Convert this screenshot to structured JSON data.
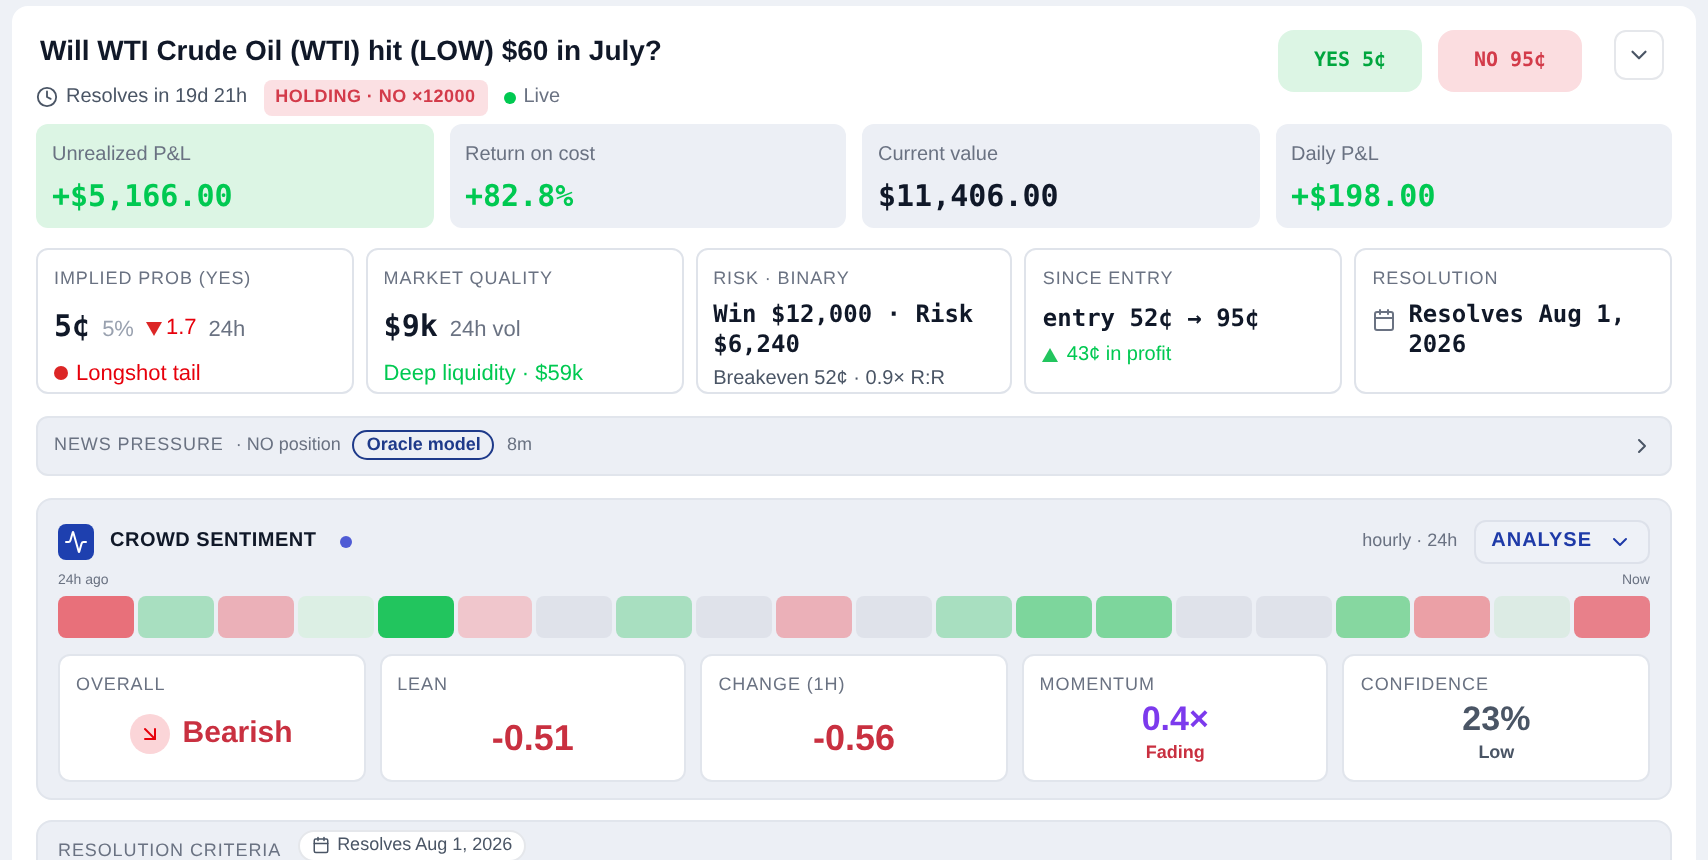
{
  "header": {
    "title": "Will WTI Crude Oil (WTI) hit (LOW) $60 in July?",
    "resolves_in": "Resolves in 19d 21h",
    "holding_badge": "HOLDING · NO ×12000",
    "live": {
      "label": "Live",
      "on": true
    }
  },
  "trade_buttons": [
    {
      "label": "YES 5¢",
      "kind": "yes"
    },
    {
      "label": "NO 95¢",
      "kind": "no"
    }
  ],
  "stats": [
    {
      "label": "Unrealized P&L",
      "value": "+$5,166.00",
      "kind": "positive",
      "highlight": true
    },
    {
      "label": "Return on cost",
      "value": "+82.8%",
      "kind": "positive",
      "highlight": false
    },
    {
      "label": "Current value",
      "value": "$11,406.00",
      "kind": "neutral",
      "highlight": false
    },
    {
      "label": "Daily P&L",
      "value": "+$198.00",
      "kind": "positive",
      "highlight": false
    }
  ],
  "info_cards": [
    {
      "kind": "prob",
      "label": "IMPLIED PROB (YES)",
      "price": "5¢",
      "pct": "5%",
      "change": "1.7",
      "period": "24h",
      "note": "Longshot tail"
    },
    {
      "kind": "quality",
      "label": "MARKET QUALITY",
      "value": "$9k",
      "sub": "24h vol",
      "note": "Deep liquidity · $59k"
    },
    {
      "kind": "risk",
      "label": "RISK · BINARY",
      "value": "Win $12,000 · Risk $6,240",
      "note": "Breakeven 52¢ · 0.9× R:R"
    },
    {
      "kind": "entry",
      "label": "SINCE ENTRY",
      "value": "entry 52¢ → 95¢",
      "note": "43¢ in profit"
    },
    {
      "kind": "resolution",
      "label": "RESOLUTION",
      "value": "Resolves Aug 1, 2026"
    }
  ],
  "news_pressure": {
    "label": "NEWS PRESSURE",
    "position": "· NO position",
    "model": "Oracle model",
    "age": "8m"
  },
  "crowd_sentiment": {
    "title": "CROWD SENTIMENT",
    "range": "hourly · 24h",
    "analyse_button": "ANALYSE",
    "start_label": "24h ago",
    "end_label": "Now",
    "cells": [
      {
        "color": "#e8707a"
      },
      {
        "color": "#a8dfc0"
      },
      {
        "color": "#ebb0b8"
      },
      {
        "color": "#dcefe4"
      },
      {
        "color": "#22c55e"
      },
      {
        "color": "#f0c6cc"
      },
      {
        "color": "#dfe2ea"
      },
      {
        "color": "#a8dfc0"
      },
      {
        "color": "#dfe2ea"
      },
      {
        "color": "#ebb0b8"
      },
      {
        "color": "#dfe2ea"
      },
      {
        "color": "#a8dfc0"
      },
      {
        "color": "#7dd69c"
      },
      {
        "color": "#7dd69c"
      },
      {
        "color": "#dfe2ea"
      },
      {
        "color": "#dfe2ea"
      },
      {
        "color": "#86d7a0"
      },
      {
        "color": "#eba0a6"
      },
      {
        "color": "#dcebe4"
      },
      {
        "color": "#e8808a"
      }
    ],
    "metrics": [
      {
        "kind": "overall",
        "label": "OVERALL",
        "value": "Bearish"
      },
      {
        "kind": "number",
        "label": "LEAN",
        "value": "-0.51"
      },
      {
        "kind": "number",
        "label": "CHANGE (1H)",
        "value": "-0.56"
      },
      {
        "kind": "momentum",
        "label": "MOMENTUM",
        "value": "0.4×",
        "sub": "Fading"
      },
      {
        "kind": "confidence",
        "label": "CONFIDENCE",
        "value": "23%",
        "sub": "Low"
      }
    ]
  },
  "resolution_criteria": {
    "label": "RESOLUTION CRITERIA",
    "date_chip": "Resolves Aug 1, 2026"
  }
}
